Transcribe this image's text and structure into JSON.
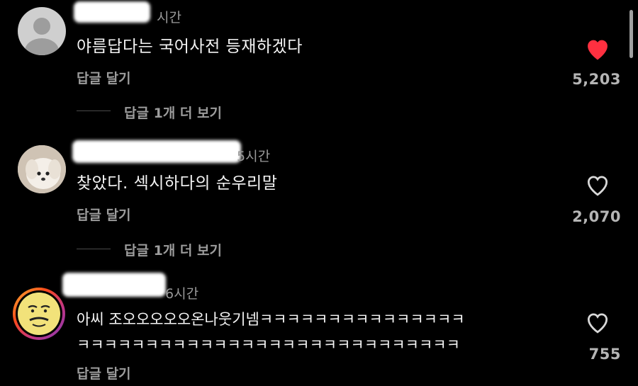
{
  "colors": {
    "background": "#000000",
    "liked_heart": "#ff3040",
    "text": "#f4f4f4",
    "muted": "#9c9c9c"
  },
  "comments": [
    {
      "time": "시간",
      "text": "야름답다는 국어사전 등재하겠다",
      "reply_label": "답글 달기",
      "view_replies": "답글 1개 더 보기",
      "likes": "5,203",
      "liked": true,
      "avatar": "default-avatar-icon"
    },
    {
      "time": "5시간",
      "text": "찾았다. 섹시하다의 순우리말",
      "reply_label": "답글 달기",
      "view_replies": "답글 1개 더 보기",
      "likes": "2,070",
      "liked": false,
      "avatar": "puppy-avatar"
    },
    {
      "time": "6시간",
      "text": "아씨 조오오오오오온나웃기넴ㅋㅋㅋㅋㅋㅋㅋㅋㅋㅋㅋㅋㅋㅋㅋ\nㅋㅋㅋㅋㅋㅋㅋㅋㅋㅋㅋㅋㅋㅋㅋㅋㅋㅋㅋㅋㅋㅋㅋㅋㅋㅋㅋㅋ",
      "reply_label": "답글 달기",
      "likes": "755",
      "liked": false,
      "avatar": "cartoon-face-avatar"
    }
  ]
}
